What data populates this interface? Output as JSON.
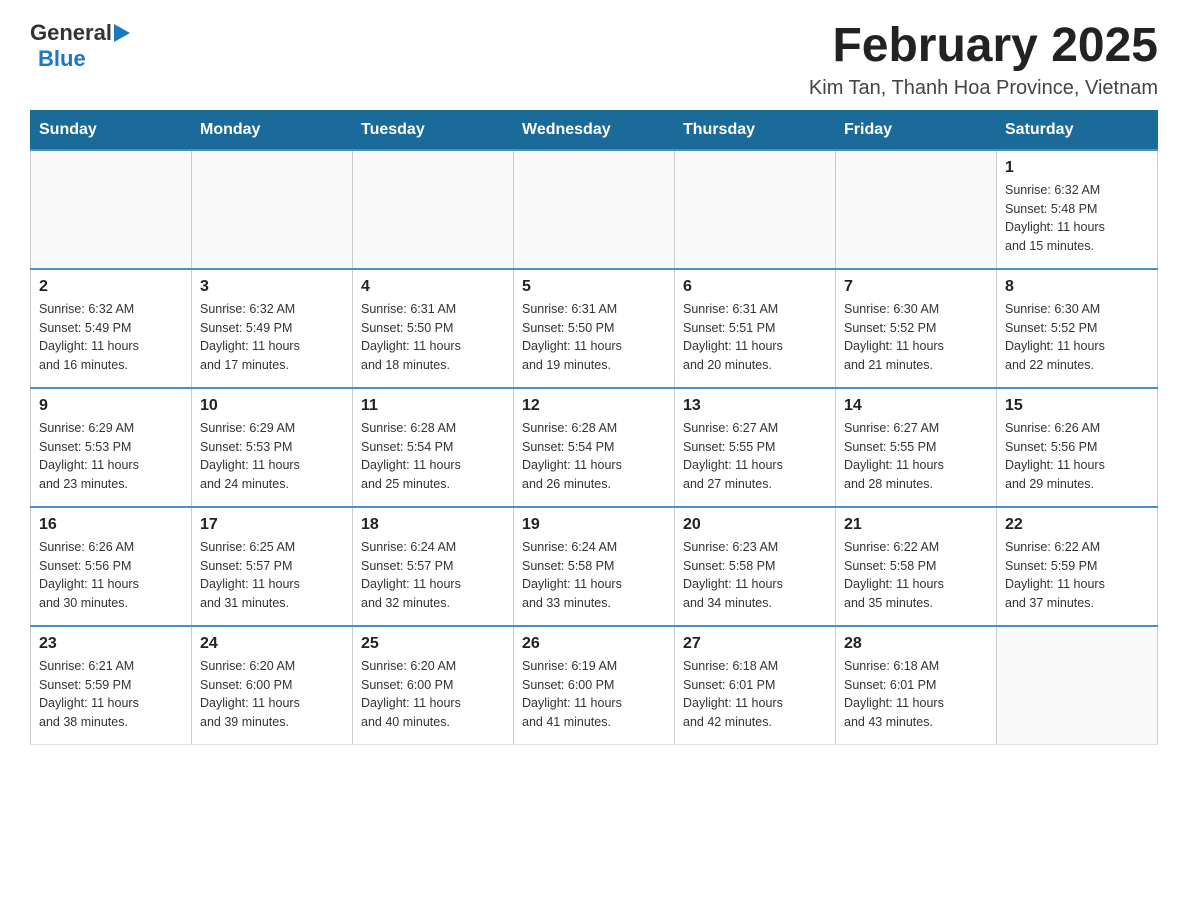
{
  "header": {
    "logo_general": "General",
    "logo_blue": "Blue",
    "month_title": "February 2025",
    "location": "Kim Tan, Thanh Hoa Province, Vietnam"
  },
  "days_of_week": [
    "Sunday",
    "Monday",
    "Tuesday",
    "Wednesday",
    "Thursday",
    "Friday",
    "Saturday"
  ],
  "weeks": [
    [
      {
        "day": "",
        "info": ""
      },
      {
        "day": "",
        "info": ""
      },
      {
        "day": "",
        "info": ""
      },
      {
        "day": "",
        "info": ""
      },
      {
        "day": "",
        "info": ""
      },
      {
        "day": "",
        "info": ""
      },
      {
        "day": "1",
        "info": "Sunrise: 6:32 AM\nSunset: 5:48 PM\nDaylight: 11 hours\nand 15 minutes."
      }
    ],
    [
      {
        "day": "2",
        "info": "Sunrise: 6:32 AM\nSunset: 5:49 PM\nDaylight: 11 hours\nand 16 minutes."
      },
      {
        "day": "3",
        "info": "Sunrise: 6:32 AM\nSunset: 5:49 PM\nDaylight: 11 hours\nand 17 minutes."
      },
      {
        "day": "4",
        "info": "Sunrise: 6:31 AM\nSunset: 5:50 PM\nDaylight: 11 hours\nand 18 minutes."
      },
      {
        "day": "5",
        "info": "Sunrise: 6:31 AM\nSunset: 5:50 PM\nDaylight: 11 hours\nand 19 minutes."
      },
      {
        "day": "6",
        "info": "Sunrise: 6:31 AM\nSunset: 5:51 PM\nDaylight: 11 hours\nand 20 minutes."
      },
      {
        "day": "7",
        "info": "Sunrise: 6:30 AM\nSunset: 5:52 PM\nDaylight: 11 hours\nand 21 minutes."
      },
      {
        "day": "8",
        "info": "Sunrise: 6:30 AM\nSunset: 5:52 PM\nDaylight: 11 hours\nand 22 minutes."
      }
    ],
    [
      {
        "day": "9",
        "info": "Sunrise: 6:29 AM\nSunset: 5:53 PM\nDaylight: 11 hours\nand 23 minutes."
      },
      {
        "day": "10",
        "info": "Sunrise: 6:29 AM\nSunset: 5:53 PM\nDaylight: 11 hours\nand 24 minutes."
      },
      {
        "day": "11",
        "info": "Sunrise: 6:28 AM\nSunset: 5:54 PM\nDaylight: 11 hours\nand 25 minutes."
      },
      {
        "day": "12",
        "info": "Sunrise: 6:28 AM\nSunset: 5:54 PM\nDaylight: 11 hours\nand 26 minutes."
      },
      {
        "day": "13",
        "info": "Sunrise: 6:27 AM\nSunset: 5:55 PM\nDaylight: 11 hours\nand 27 minutes."
      },
      {
        "day": "14",
        "info": "Sunrise: 6:27 AM\nSunset: 5:55 PM\nDaylight: 11 hours\nand 28 minutes."
      },
      {
        "day": "15",
        "info": "Sunrise: 6:26 AM\nSunset: 5:56 PM\nDaylight: 11 hours\nand 29 minutes."
      }
    ],
    [
      {
        "day": "16",
        "info": "Sunrise: 6:26 AM\nSunset: 5:56 PM\nDaylight: 11 hours\nand 30 minutes."
      },
      {
        "day": "17",
        "info": "Sunrise: 6:25 AM\nSunset: 5:57 PM\nDaylight: 11 hours\nand 31 minutes."
      },
      {
        "day": "18",
        "info": "Sunrise: 6:24 AM\nSunset: 5:57 PM\nDaylight: 11 hours\nand 32 minutes."
      },
      {
        "day": "19",
        "info": "Sunrise: 6:24 AM\nSunset: 5:58 PM\nDaylight: 11 hours\nand 33 minutes."
      },
      {
        "day": "20",
        "info": "Sunrise: 6:23 AM\nSunset: 5:58 PM\nDaylight: 11 hours\nand 34 minutes."
      },
      {
        "day": "21",
        "info": "Sunrise: 6:22 AM\nSunset: 5:58 PM\nDaylight: 11 hours\nand 35 minutes."
      },
      {
        "day": "22",
        "info": "Sunrise: 6:22 AM\nSunset: 5:59 PM\nDaylight: 11 hours\nand 37 minutes."
      }
    ],
    [
      {
        "day": "23",
        "info": "Sunrise: 6:21 AM\nSunset: 5:59 PM\nDaylight: 11 hours\nand 38 minutes."
      },
      {
        "day": "24",
        "info": "Sunrise: 6:20 AM\nSunset: 6:00 PM\nDaylight: 11 hours\nand 39 minutes."
      },
      {
        "day": "25",
        "info": "Sunrise: 6:20 AM\nSunset: 6:00 PM\nDaylight: 11 hours\nand 40 minutes."
      },
      {
        "day": "26",
        "info": "Sunrise: 6:19 AM\nSunset: 6:00 PM\nDaylight: 11 hours\nand 41 minutes."
      },
      {
        "day": "27",
        "info": "Sunrise: 6:18 AM\nSunset: 6:01 PM\nDaylight: 11 hours\nand 42 minutes."
      },
      {
        "day": "28",
        "info": "Sunrise: 6:18 AM\nSunset: 6:01 PM\nDaylight: 11 hours\nand 43 minutes."
      },
      {
        "day": "",
        "info": ""
      }
    ]
  ]
}
